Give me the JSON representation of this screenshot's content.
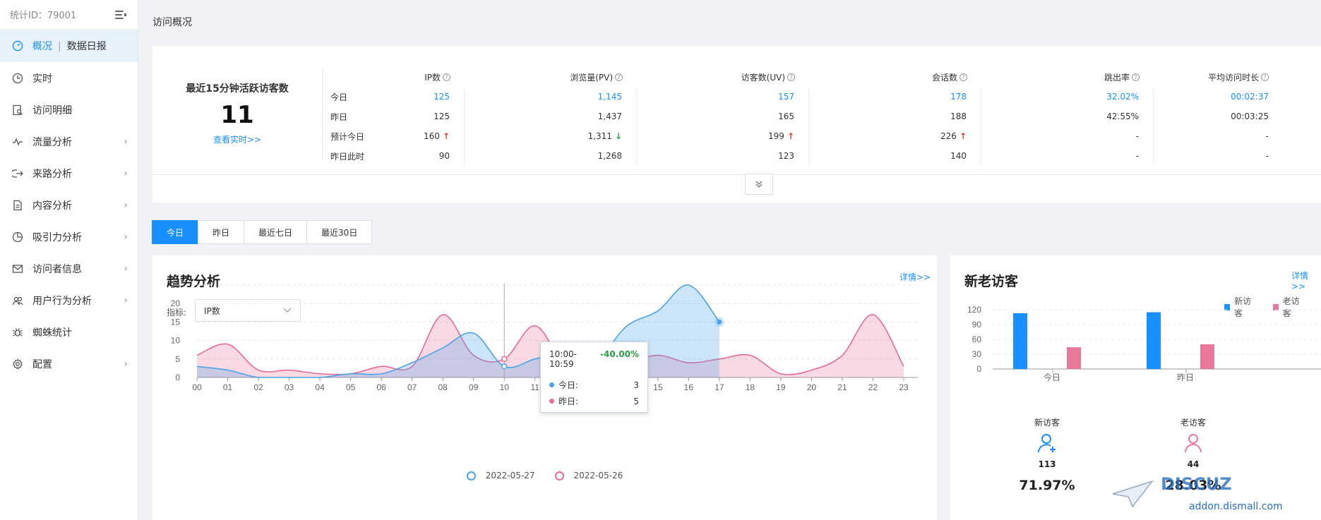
{
  "sidebar": {
    "stats_id": "统计ID：79001",
    "items": [
      {
        "label": "概况",
        "sub": "数据日报",
        "icon": "gauge-icon",
        "active": true
      },
      {
        "label": "实时",
        "icon": "clock-icon"
      },
      {
        "label": "访问明细",
        "icon": "search-doc-icon"
      },
      {
        "label": "流量分析",
        "icon": "pulse-icon",
        "arrow": true
      },
      {
        "label": "来路分析",
        "icon": "source-icon",
        "arrow": true
      },
      {
        "label": "内容分析",
        "icon": "doc-icon",
        "arrow": true
      },
      {
        "label": "吸引力分析",
        "icon": "pie-icon",
        "arrow": true
      },
      {
        "label": "访问者信息",
        "icon": "mail-icon",
        "arrow": true
      },
      {
        "label": "用户行为分析",
        "icon": "users-icon",
        "arrow": true
      },
      {
        "label": "蜘蛛统计",
        "icon": "spider-icon"
      },
      {
        "label": "配置",
        "icon": "gear-icon",
        "arrow": true
      }
    ]
  },
  "header": {
    "title": "访问概况"
  },
  "overview": {
    "active_title": "最近15分钟活跃访客数",
    "active_count": "11",
    "active_link": "查看实时>>",
    "columns": [
      "IP数",
      "浏览量(PV)",
      "访客数(UV)",
      "会话数",
      "跳出率",
      "平均访问时长"
    ],
    "rows": [
      {
        "label": "今日",
        "values": [
          "125",
          "1,145",
          "157",
          "178",
          "32.02%",
          "00:02:37"
        ]
      },
      {
        "label": "昨日",
        "values": [
          "125",
          "1,437",
          "165",
          "188",
          "42.55%",
          "00:03:25"
        ]
      },
      {
        "label": "预计今日",
        "values": [
          "160",
          "1,311",
          "199",
          "226",
          "-",
          "-"
        ]
      },
      {
        "label": "昨日此时",
        "values": [
          "90",
          "1,268",
          "123",
          "140",
          "-",
          "-"
        ]
      }
    ],
    "trend_arrows": {
      "ip": "↑",
      "pv": "↓",
      "uv": "↑",
      "sessions": "↑"
    }
  },
  "tabs": [
    "今日",
    "昨日",
    "最近七日",
    "最近30日"
  ],
  "trend": {
    "title": "趋势分析",
    "detail_link": "详情>>",
    "metric_label": "指标:",
    "metric_value": "IP数",
    "tooltip": {
      "range": "10:00-10:59",
      "pct": "-40.00%",
      "today_label": "今日:",
      "today_value": "3",
      "yesterday_label": "昨日:",
      "yesterday_value": "5"
    }
  },
  "chart_data": {
    "type": "area",
    "x": [
      "00",
      "01",
      "02",
      "03",
      "04",
      "05",
      "06",
      "07",
      "08",
      "09",
      "10",
      "11",
      "12",
      "13",
      "14",
      "15",
      "16",
      "17",
      "18",
      "19",
      "20",
      "21",
      "22",
      "23"
    ],
    "ylim": [
      0,
      25
    ],
    "yticks": [
      0,
      5,
      10,
      15,
      20,
      25
    ],
    "series": [
      {
        "name": "2022-05-27",
        "color": "#4aa3e8",
        "values": [
          3,
          2,
          0,
          0,
          0,
          1,
          1,
          4,
          8,
          12,
          3,
          5,
          7,
          5,
          14,
          18,
          25,
          15
        ]
      },
      {
        "name": "2022-05-26",
        "color": "#e86b95",
        "values": [
          6,
          9,
          2,
          2,
          1,
          1,
          3,
          3,
          17,
          6,
          5,
          14,
          3,
          2,
          4,
          6,
          4,
          5,
          6,
          1,
          2,
          6,
          17,
          3
        ]
      }
    ],
    "grid": true
  },
  "visitors": {
    "title": "新老访客",
    "detail_link": "详情>>",
    "legend_new": "新访客",
    "legend_old": "老访客",
    "new_color": "#1890ff",
    "old_color": "#e8799a",
    "categories": [
      "今日",
      "昨日"
    ],
    "yticks": [
      0,
      30,
      60,
      90,
      120
    ],
    "ylim": [
      0,
      120
    ],
    "new_values": [
      113,
      115
    ],
    "old_values": [
      44,
      50
    ],
    "new_label": "新访客",
    "old_label": "老访客",
    "new_count": "113",
    "old_count": "44",
    "new_pct": "71.97%",
    "old_pct": "28.03%"
  },
  "watermark": {
    "logo": "DISCUZ",
    "text": "addon.dismall.com"
  }
}
